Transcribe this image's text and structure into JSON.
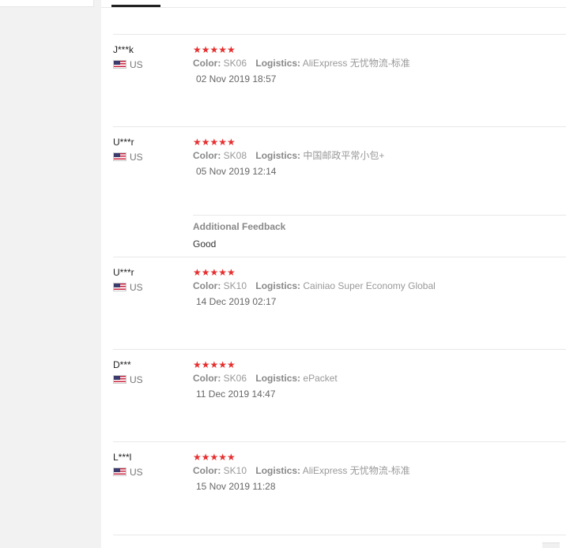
{
  "reviews": [
    {
      "user": "J***k",
      "country": "US",
      "stars": "★★★★★",
      "color_label": "Color:",
      "color": "SK06",
      "logistics_label": "Logistics:",
      "logistics": "AliExpress 无忧物流-标准",
      "date": "02 Nov 2019 18:57"
    },
    {
      "user": "U***r",
      "country": "US",
      "stars": "★★★★★",
      "color_label": "Color:",
      "color": "SK08",
      "logistics_label": "Logistics:",
      "logistics": "中国邮政平常小包+",
      "date": "05 Nov 2019 12:14",
      "additional_title": "Additional Feedback",
      "additional_text": "Good"
    },
    {
      "user": "U***r",
      "country": "US",
      "stars": "★★★★★",
      "color_label": "Color:",
      "color": "SK10",
      "logistics_label": "Logistics:",
      "logistics": "Cainiao Super Economy Global",
      "date": "14 Dec 2019 02:17"
    },
    {
      "user": "D***",
      "country": "US",
      "stars": "★★★★★",
      "color_label": "Color:",
      "color": "SK06",
      "logistics_label": "Logistics:",
      "logistics": "ePacket",
      "date": "11 Dec 2019 14:47"
    },
    {
      "user": "L***l",
      "country": "US",
      "stars": "★★★★★",
      "color_label": "Color:",
      "color": "SK10",
      "logistics_label": "Logistics:",
      "logistics": "AliExpress 无忧物流-标准",
      "date": "15 Nov 2019 11:28"
    }
  ],
  "colors": {
    "star": "#e62e2e",
    "divider": "#e8e8e8",
    "rail": "#f2f2f2"
  }
}
